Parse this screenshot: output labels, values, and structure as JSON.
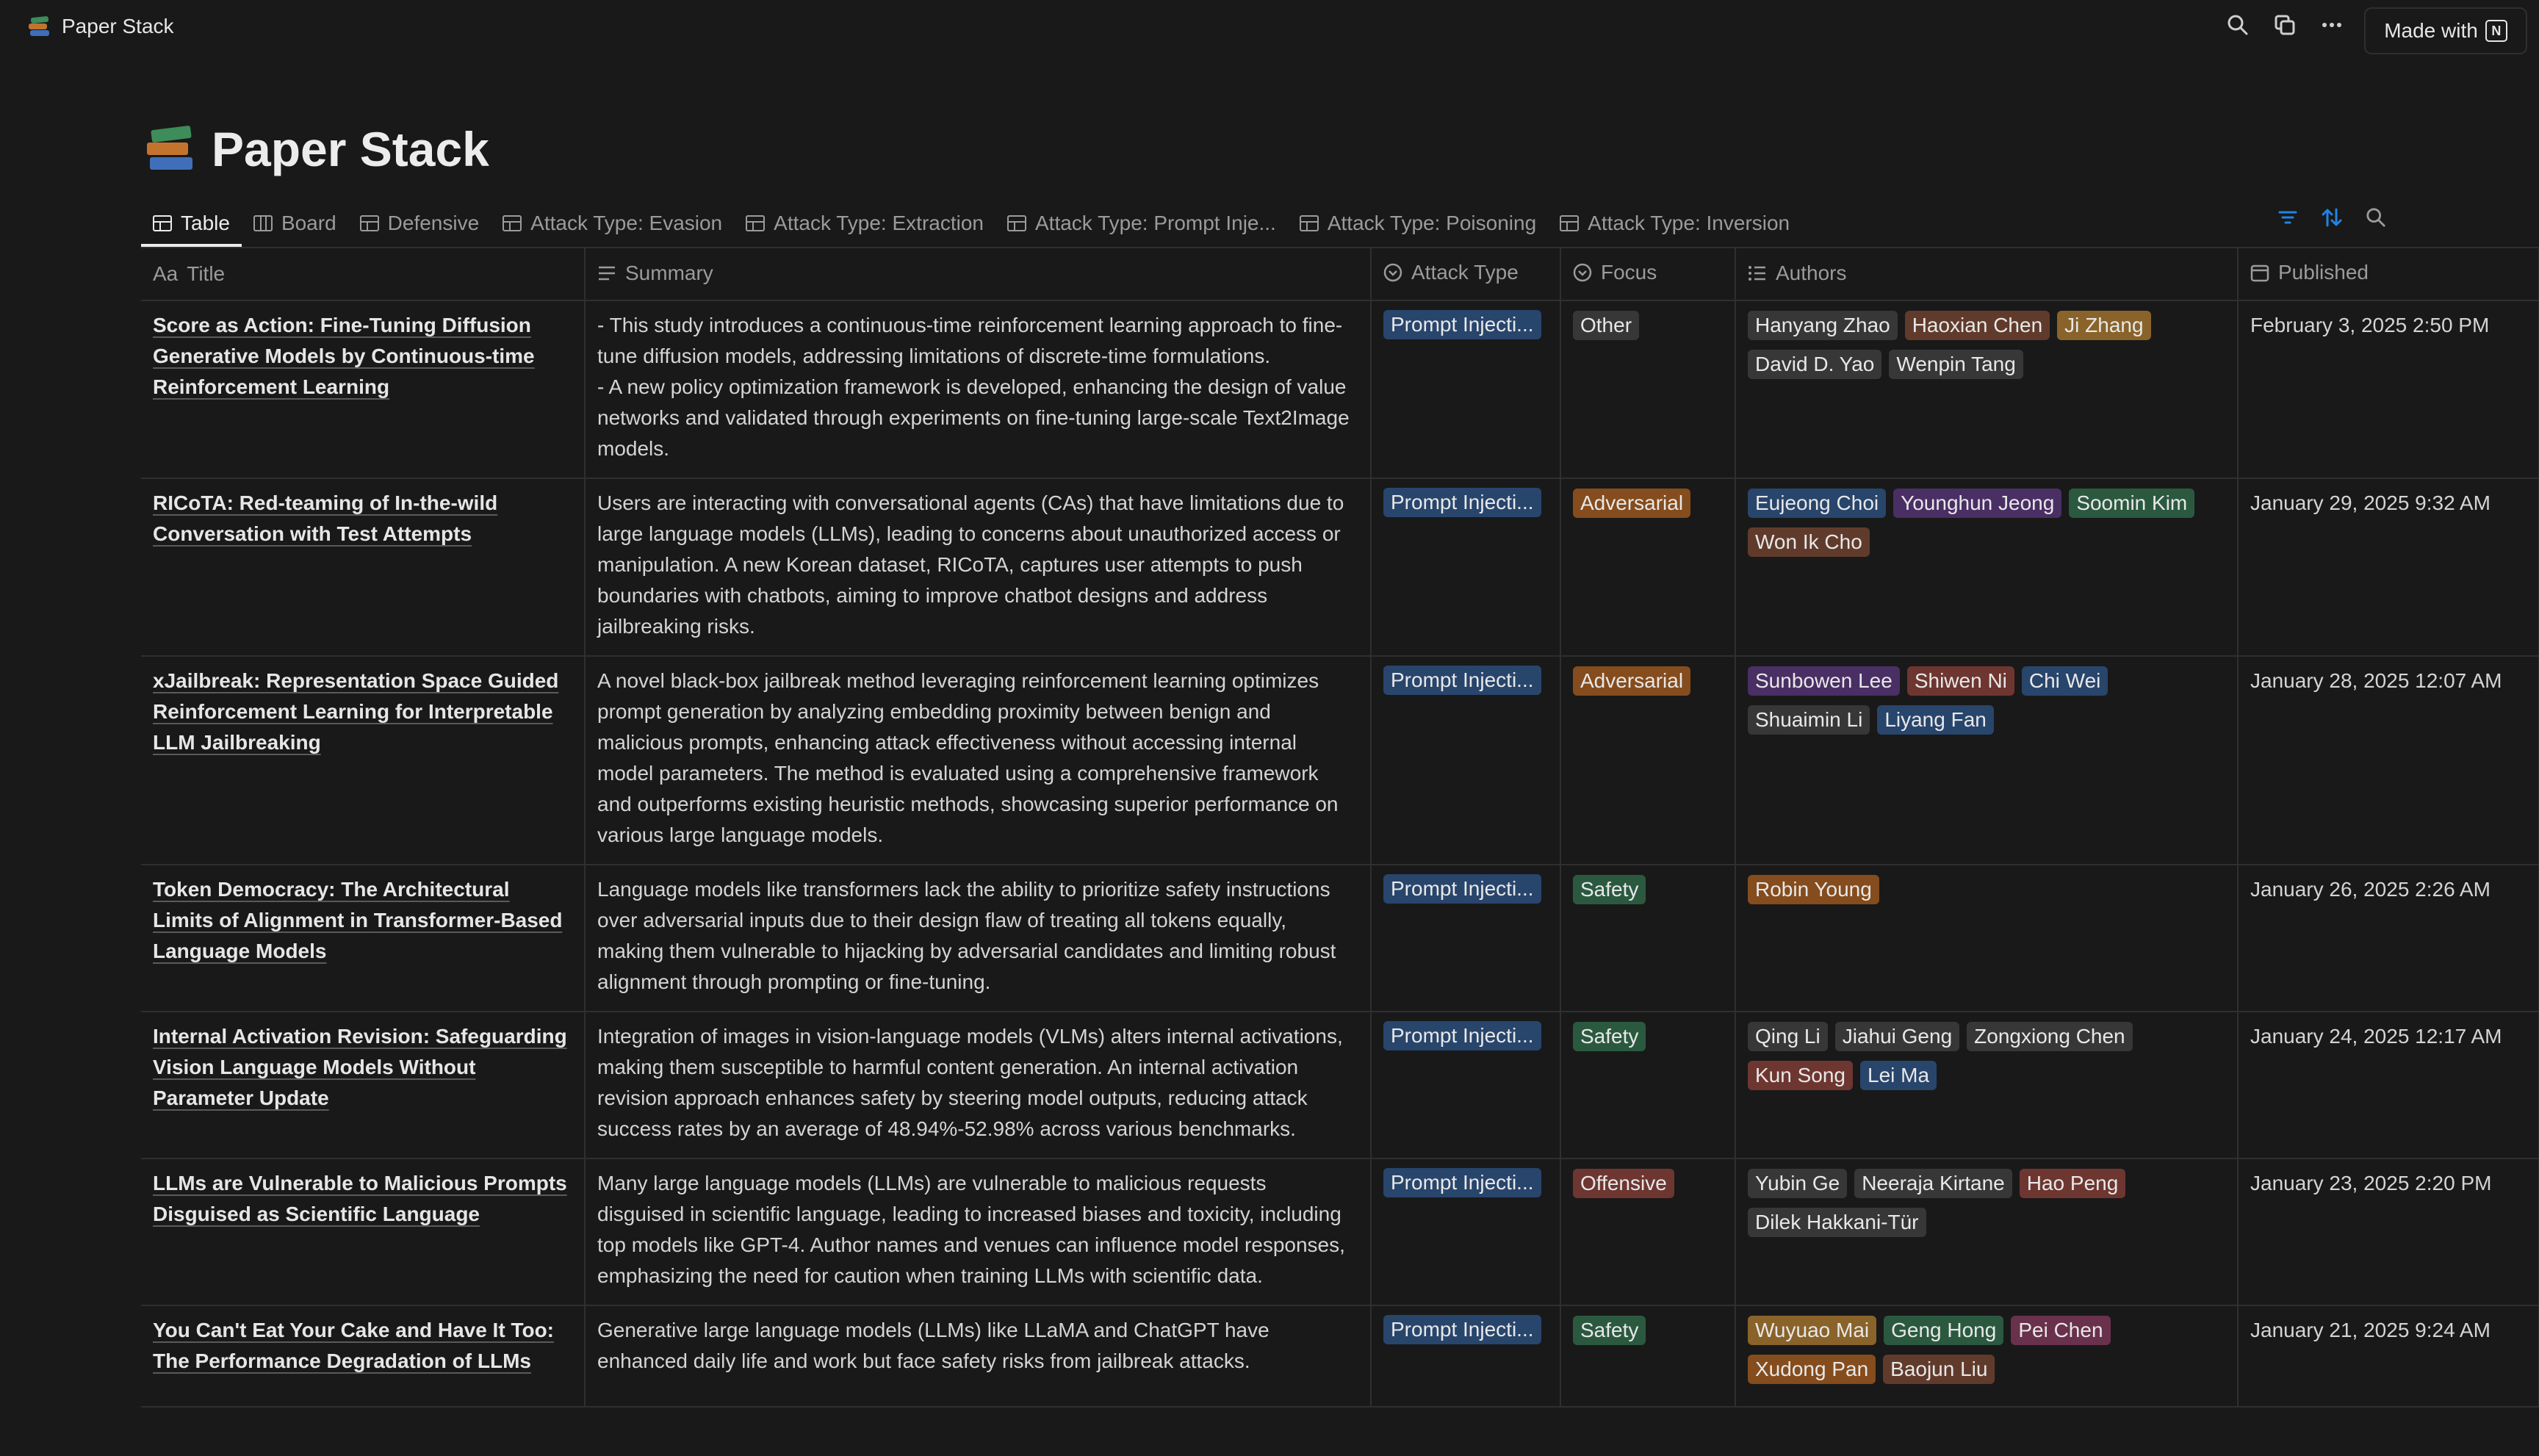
{
  "app": {
    "title": "Paper Stack",
    "made_with_label": "Made with",
    "made_with_badge": "N"
  },
  "page": {
    "title": "Paper Stack"
  },
  "tabs": [
    {
      "label": "Table",
      "icon": "table-icon"
    },
    {
      "label": "Board",
      "icon": "board-icon"
    },
    {
      "label": "Defensive",
      "icon": "table-icon"
    },
    {
      "label": "Attack Type: Evasion",
      "icon": "table-icon"
    },
    {
      "label": "Attack Type: Extraction",
      "icon": "table-icon"
    },
    {
      "label": "Attack Type: Prompt Inje...",
      "icon": "table-icon"
    },
    {
      "label": "Attack Type: Poisoning",
      "icon": "table-icon"
    },
    {
      "label": "Attack Type: Inversion",
      "icon": "table-icon"
    }
  ],
  "columns": {
    "title": "Title",
    "summary": "Summary",
    "attack_type": "Attack Type",
    "focus": "Focus",
    "authors": "Authors",
    "published": "Published",
    "title_prefix": "Aa"
  },
  "colors": {
    "blue": "#28456c",
    "gray": "#373737",
    "brown": "#603b2c",
    "orange": "#854c1d",
    "yellow": "#89632a",
    "green": "#2b593f",
    "purple": "#492f64",
    "pink": "#69314c",
    "red": "#6e3630",
    "accent": "#2383e2"
  },
  "rows": [
    {
      "title": "Score as Action: Fine-Tuning Diffusion Generative Models by Continuous-time Reinforcement Learning",
      "summary": "- This study introduces a continuous-time reinforcement learning approach to fine-tune diffusion models, addressing limitations of discrete-time formulations.\n- A new policy optimization framework is developed, enhancing the design of value networks and validated through experiments on fine-tuning large-scale Text2Image models.",
      "attack_type": "Prompt Injecti...",
      "focus": "Other",
      "focus_color": "gray",
      "authors": [
        {
          "name": "Hanyang Zhao",
          "color": "gray"
        },
        {
          "name": "Haoxian Chen",
          "color": "brown"
        },
        {
          "name": "Ji Zhang",
          "color": "yellow"
        },
        {
          "name": "David D. Yao",
          "color": "gray"
        },
        {
          "name": "Wenpin Tang",
          "color": "gray"
        }
      ],
      "published": "February 3, 2025 2:50 PM"
    },
    {
      "title": "RICoTA: Red-teaming of In-the-wild Conversation with Test Attempts",
      "summary": "Users are interacting with conversational agents (CAs) that have limitations due to large language models (LLMs), leading to concerns about unauthorized access or manipulation. A new Korean dataset, RICoTA, captures user attempts to push boundaries with chatbots, aiming to improve chatbot designs and address jailbreaking risks.",
      "attack_type": "Prompt Injecti...",
      "focus": "Adversarial",
      "focus_color": "orange",
      "authors": [
        {
          "name": "Eujeong Choi",
          "color": "blue"
        },
        {
          "name": "Younghun Jeong",
          "color": "purple"
        },
        {
          "name": "Soomin Kim",
          "color": "green"
        },
        {
          "name": "Won Ik Cho",
          "color": "brown"
        }
      ],
      "published": "January 29, 2025 9:32 AM"
    },
    {
      "title": "xJailbreak: Representation Space Guided Reinforcement Learning for Interpretable LLM Jailbreaking",
      "summary": "A novel black-box jailbreak method leveraging reinforcement learning optimizes prompt generation by analyzing embedding proximity between benign and malicious prompts, enhancing attack effectiveness without accessing internal model parameters. The method is evaluated using a comprehensive framework and outperforms existing heuristic methods, showcasing superior performance on various large language models.",
      "attack_type": "Prompt Injecti...",
      "focus": "Adversarial",
      "focus_color": "orange",
      "authors": [
        {
          "name": "Sunbowen Lee",
          "color": "purple"
        },
        {
          "name": "Shiwen Ni",
          "color": "red"
        },
        {
          "name": "Chi Wei",
          "color": "blue"
        },
        {
          "name": "Shuaimin Li",
          "color": "gray"
        },
        {
          "name": "Liyang Fan",
          "color": "blue"
        }
      ],
      "published": "January 28, 2025 12:07 AM"
    },
    {
      "title": "Token Democracy: The Architectural Limits of Alignment in Transformer-Based Language Models",
      "summary": "Language models like transformers lack the ability to prioritize safety instructions over adversarial inputs due to their design flaw of treating all tokens equally, making them vulnerable to hijacking by adversarial candidates and limiting robust alignment through prompting or fine-tuning.",
      "attack_type": "Prompt Injecti...",
      "focus": "Safety",
      "focus_color": "green",
      "authors": [
        {
          "name": "Robin Young",
          "color": "orange"
        }
      ],
      "published": "January 26, 2025 2:26 AM"
    },
    {
      "title": "Internal Activation Revision: Safeguarding Vision Language Models Without Parameter Update",
      "summary": "Integration of images in vision-language models (VLMs) alters internal activations, making them susceptible to harmful content generation. An internal activation revision approach enhances safety by steering model outputs, reducing attack success rates by an average of 48.94%-52.98% across various benchmarks.",
      "attack_type": "Prompt Injecti...",
      "focus": "Safety",
      "focus_color": "green",
      "authors": [
        {
          "name": "Qing Li",
          "color": "gray"
        },
        {
          "name": "Jiahui Geng",
          "color": "gray"
        },
        {
          "name": "Zongxiong Chen",
          "color": "gray"
        },
        {
          "name": "Kun Song",
          "color": "red"
        },
        {
          "name": "Lei Ma",
          "color": "blue"
        }
      ],
      "published": "January 24, 2025 12:17 AM"
    },
    {
      "title": "LLMs are Vulnerable to Malicious Prompts Disguised as Scientific Language",
      "summary": "Many large language models (LLMs) are vulnerable to malicious requests disguised in scientific language, leading to increased biases and toxicity, including top models like GPT-4. Author names and venues can influence model responses, emphasizing the need for caution when training LLMs with scientific data.",
      "attack_type": "Prompt Injecti...",
      "focus": "Offensive",
      "focus_color": "red",
      "authors": [
        {
          "name": "Yubin Ge",
          "color": "gray"
        },
        {
          "name": "Neeraja Kirtane",
          "color": "gray"
        },
        {
          "name": "Hao Peng",
          "color": "red"
        },
        {
          "name": "Dilek Hakkani-Tür",
          "color": "gray"
        }
      ],
      "published": "January 23, 2025 2:20 PM"
    },
    {
      "title": "You Can't Eat Your Cake and Have It Too: The Performance Degradation of LLMs",
      "summary": "Generative large language models (LLMs) like LLaMA and ChatGPT have enhanced daily life and work but face safety risks from jailbreak attacks.",
      "attack_type": "Prompt Injecti...",
      "focus": "Safety",
      "focus_color": "green",
      "authors": [
        {
          "name": "Wuyuao Mai",
          "color": "yellow"
        },
        {
          "name": "Geng Hong",
          "color": "green"
        },
        {
          "name": "Pei Chen",
          "color": "pink"
        },
        {
          "name": "Xudong Pan",
          "color": "orange"
        },
        {
          "name": "Baojun Liu",
          "color": "brown"
        }
      ],
      "published": "January 21, 2025 9:24 AM"
    }
  ]
}
